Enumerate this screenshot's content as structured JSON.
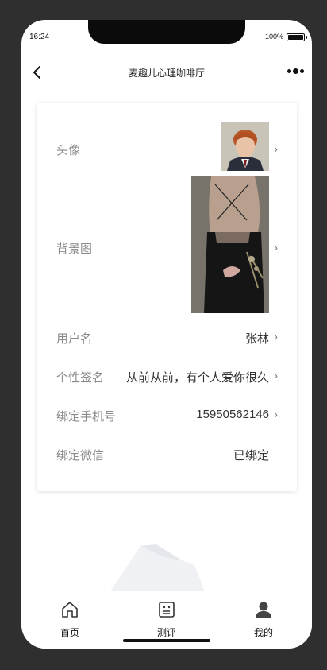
{
  "status": {
    "time": "16:24",
    "battery": "100%"
  },
  "nav": {
    "title": "麦趣儿心理咖啡厅"
  },
  "profile": {
    "avatar_label": "头像",
    "background_label": "背景图",
    "username_label": "用户名",
    "username_value": "张林",
    "signature_label": "个性签名",
    "signature_value": "从前从前，有个人爱你很久",
    "phone_label": "绑定手机号",
    "phone_value": "15950562146",
    "wechat_label": "绑定微信",
    "wechat_value": "已绑定"
  },
  "tabs": [
    {
      "label": "首页",
      "icon": "home-icon"
    },
    {
      "label": "测评",
      "icon": "assessment-icon"
    },
    {
      "label": "我的",
      "icon": "user-icon"
    }
  ],
  "colors": {
    "accent": "#111111",
    "label": "#8a8a8a",
    "value": "#333333"
  }
}
